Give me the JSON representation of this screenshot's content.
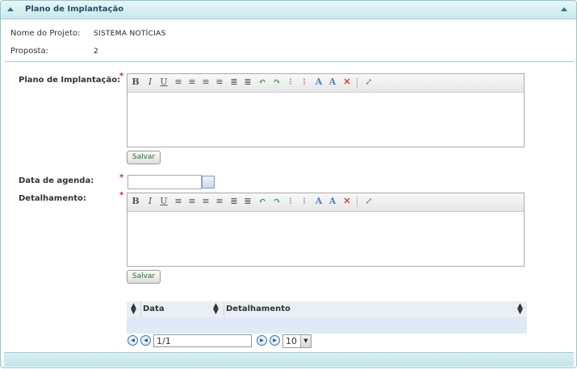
{
  "panel": {
    "title": "Plano de Implantação"
  },
  "project": {
    "name_label": "Nome do Projeto:",
    "name_value": "SISTEMA NOTÍCIAS",
    "proposal_label": "Proposta:",
    "proposal_value": "2"
  },
  "form": {
    "plano_label": "Plano de Implantação:",
    "date_label": "Data de agenda:",
    "detail_label": "Detalhamento:",
    "required_mark": "*",
    "save_label": "Salvar",
    "date_value": ""
  },
  "editor_toolbar": [
    "bold-icon",
    "italic-icon",
    "underline-icon",
    "align-left-icon",
    "align-center-icon",
    "align-right-icon",
    "justify-icon",
    "outdent-icon",
    "indent-icon",
    "undo-icon",
    "redo-icon",
    "ordered-list-icon",
    "unordered-list-icon",
    "format-icon",
    "remove-format-icon",
    "delete-icon",
    "fullscreen-icon"
  ],
  "grid": {
    "columns": [
      "Data",
      "Detalhamento"
    ],
    "rows": []
  },
  "pagination": {
    "page_value": "1/1",
    "page_size": "10"
  }
}
